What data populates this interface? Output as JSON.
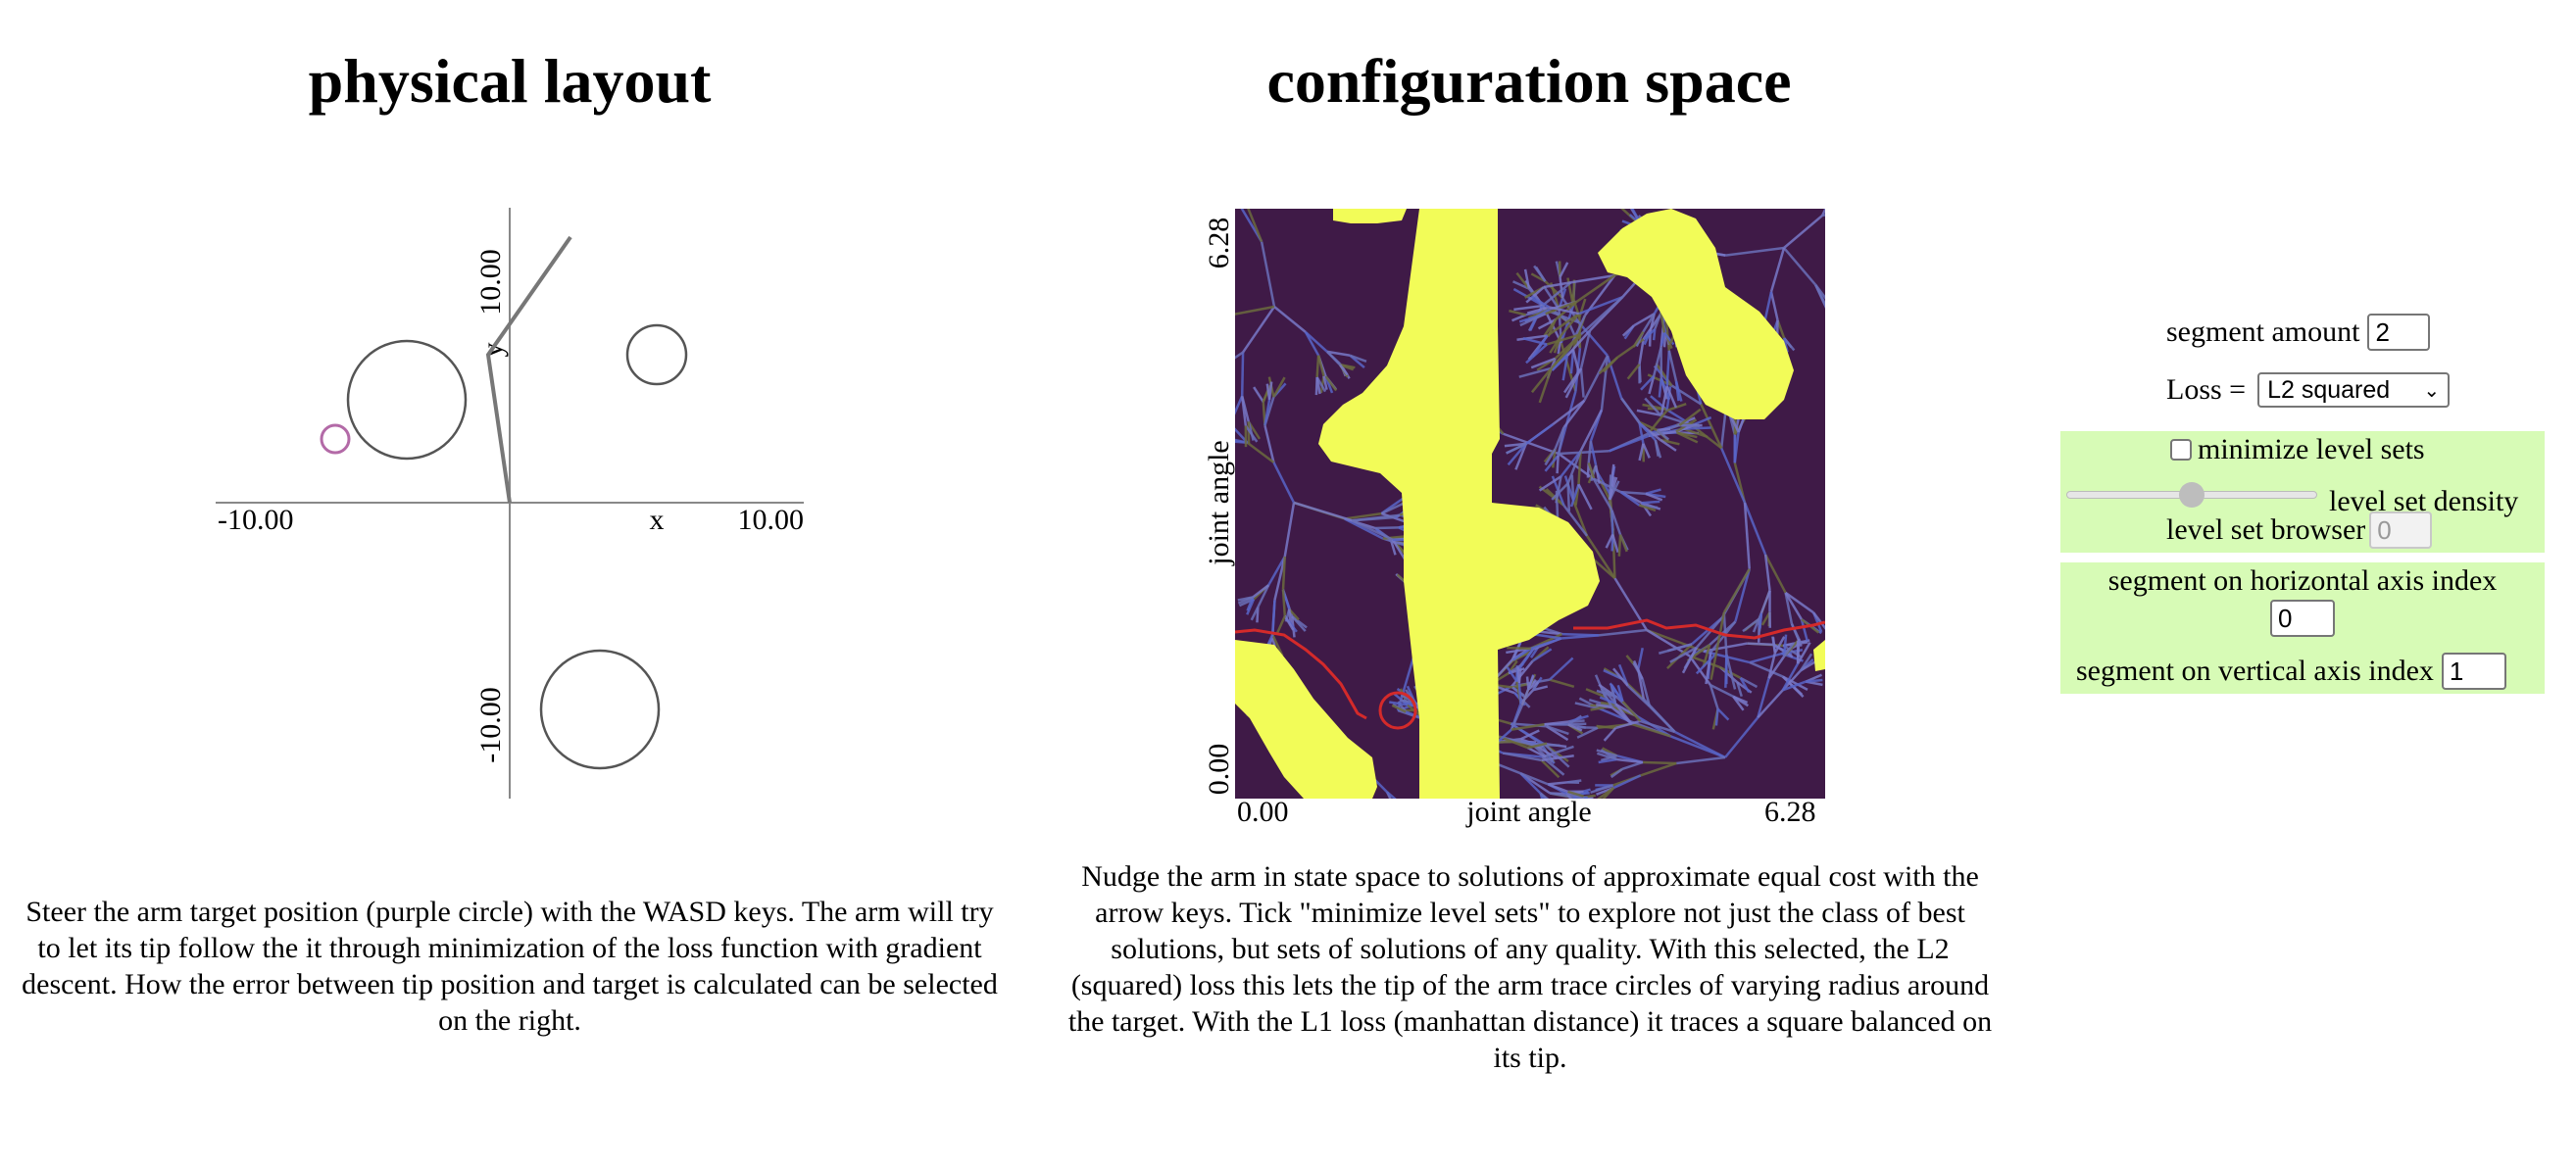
{
  "left_panel": {
    "title": "physical layout",
    "x_label": "x",
    "y_label": "y",
    "x_min": "-10.00",
    "x_max": "10.00",
    "y_min": "-10.00",
    "y_max": "10.00",
    "description": "Steer the arm target position (purple circle) with the WASD keys. The arm will try to let its tip follow the it through minimization of the loss function with gradient descent. How the error between tip position and target is calculated can be selected on the right.",
    "colors": {
      "target": "#b36aa7",
      "arm": "#777777",
      "obstacle": "#555555"
    }
  },
  "middle_panel": {
    "title": "configuration space",
    "x_label": "joint angle",
    "y_label": "joint angle",
    "x_min": "0.00",
    "x_max": "6.28",
    "y_min": "0.00",
    "y_max": "6.28",
    "description": "Nudge the arm in state space to solutions of approximate equal cost with the arrow keys. Tick \"minimize level sets\" to explore not just the class of best solutions, but sets of solutions of any quality. With this selected, the L2 (squared) loss this lets the tip of the arm trace circles of varying radius around the target. With the L1 loss (manhattan distance) it traces a square balanced on its tip.",
    "colors": {
      "background": "#3f1a47",
      "collision": "#f2fc58",
      "path": "#d42a2a",
      "tree_blue": "#5865c8",
      "tree_olive": "#6b6a3e"
    }
  },
  "controls": {
    "segment_amount_label": "segment amount",
    "segment_amount_value": "2",
    "loss_label": "Loss =",
    "loss_selected": "L2 squared",
    "minimize_label": "minimize level sets",
    "minimize_checked": false,
    "density_label": "level set density",
    "density_level": 0.5,
    "browser_label": "level set browser",
    "browser_value": "0",
    "horizontal_label": "segment on horizontal axis index",
    "horizontal_value": "0",
    "vertical_label": "segment on vertical axis index",
    "vertical_value": "1",
    "panel_color": "#d7fbb6"
  }
}
